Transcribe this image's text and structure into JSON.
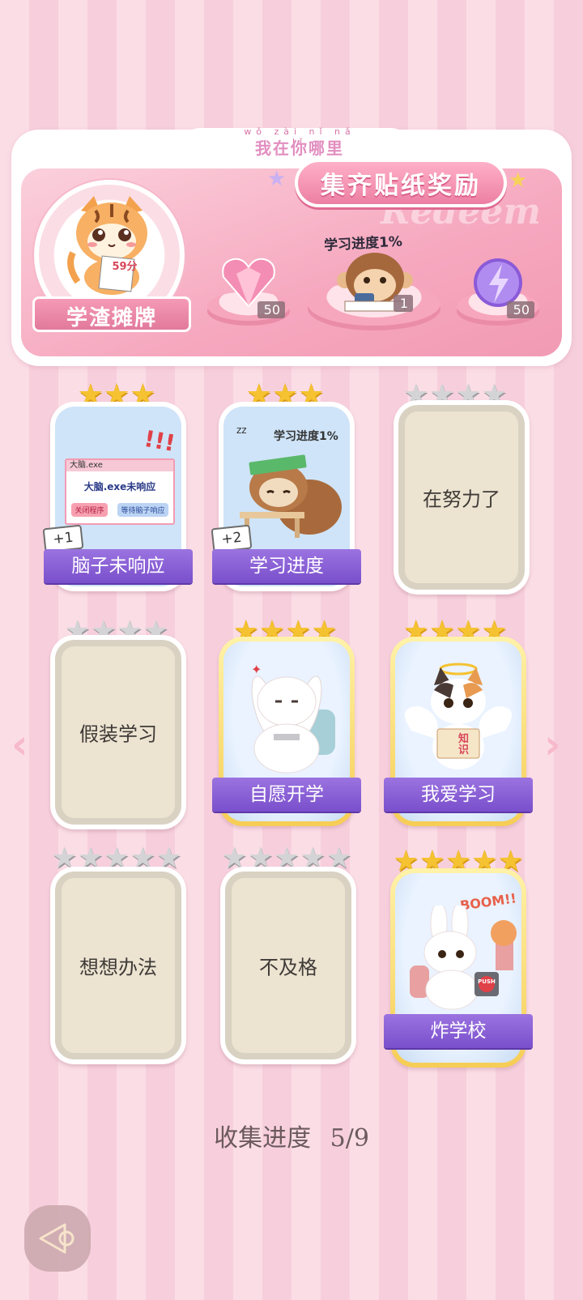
{
  "header": {
    "pinyin": "wǒ zài nǐ nǎ lǐ",
    "tagline": "我在你哪里",
    "title": "集齐贴纸奖励",
    "watermark": "Redeem",
    "avatar_label": "学渣摊牌",
    "avatar_paper": "59分",
    "progress_tag": "学习进度1%",
    "rewards": [
      {
        "icon": "pink-heart-gem-icon",
        "count": "50"
      },
      {
        "icon": "monkey-studying-icon",
        "count": "1"
      },
      {
        "icon": "purple-lightning-orb-icon",
        "count": "50"
      }
    ]
  },
  "cards": [
    {
      "title": "脑子未响应",
      "stars": 3,
      "max_stars": 3,
      "unlocked": true,
      "bonus": "+1",
      "art": {
        "window_title": "大脑.exe",
        "message": "大脑.exe未响应",
        "btn1": "关闭程序",
        "btn2": "等待脑子响应"
      }
    },
    {
      "title": "学习进度",
      "stars": 3,
      "max_stars": 3,
      "unlocked": true,
      "bonus": "+2",
      "art": {
        "bubble": "学习进度1%"
      }
    },
    {
      "title": "在努力了",
      "stars": 0,
      "max_stars": 4,
      "unlocked": false
    },
    {
      "title": "假装学习",
      "stars": 0,
      "max_stars": 4,
      "unlocked": false
    },
    {
      "title": "自愿开学",
      "stars": 4,
      "max_stars": 4,
      "unlocked": true
    },
    {
      "title": "我爱学习",
      "stars": 4,
      "max_stars": 4,
      "unlocked": true,
      "art": {
        "book": "知识"
      }
    },
    {
      "title": "想想办法",
      "stars": 0,
      "max_stars": 5,
      "unlocked": false
    },
    {
      "title": "不及格",
      "stars": 0,
      "max_stars": 5,
      "unlocked": false
    },
    {
      "title": "炸学校",
      "stars": 5,
      "max_stars": 5,
      "unlocked": true,
      "art": {
        "boom": "BOOM!!",
        "button": "PUSH"
      }
    }
  ],
  "footer": {
    "progress_label": "收集进度",
    "progress_value": "5/9"
  },
  "colors": {
    "ribbon": "#8a5fd6",
    "gold_star": "#f5c231",
    "grey_star": "#d4d4d6",
    "banner_pink": "#f6a8bf"
  }
}
